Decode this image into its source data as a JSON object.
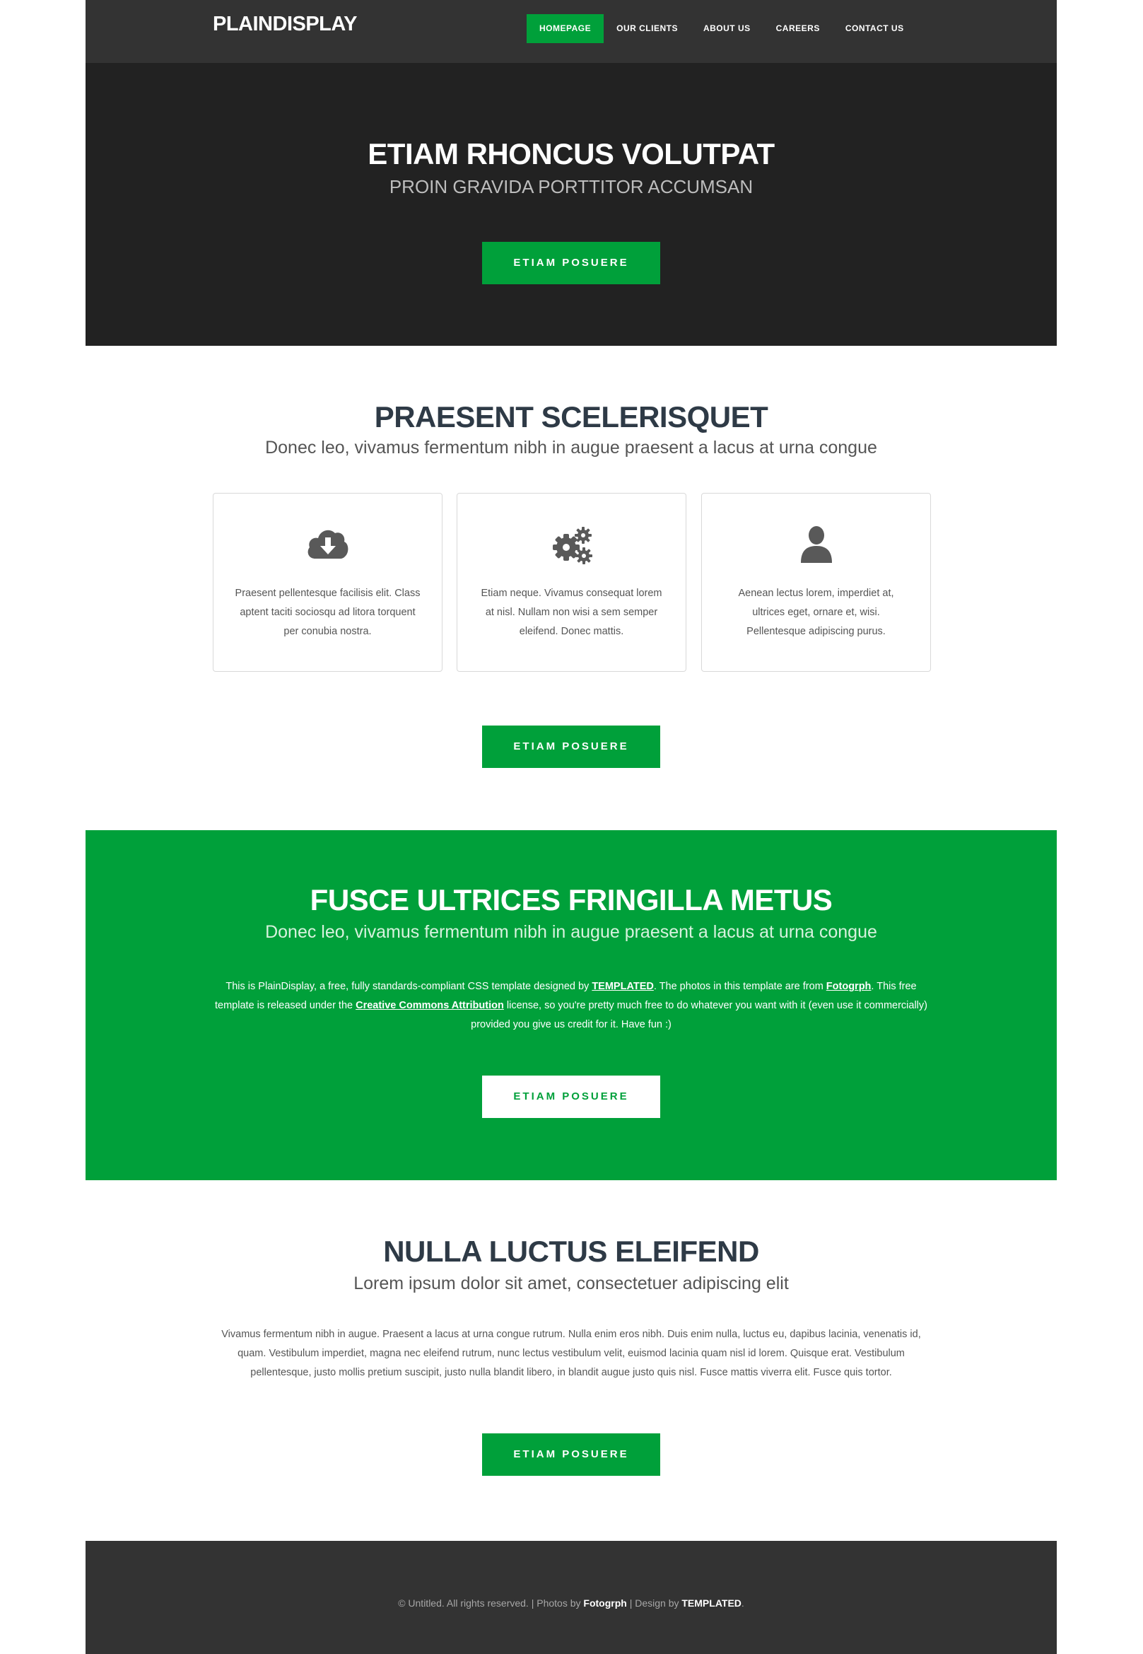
{
  "header": {
    "logo": "PLAINDISPLAY",
    "nav": [
      {
        "label": "HOMEPAGE",
        "active": true
      },
      {
        "label": "OUR CLIENTS",
        "active": false
      },
      {
        "label": "ABOUT US",
        "active": false
      },
      {
        "label": "CAREERS",
        "active": false
      },
      {
        "label": "CONTACT US",
        "active": false
      }
    ]
  },
  "hero": {
    "title": "ETIAM RHONCUS VOLUTPAT",
    "subtitle": "PROIN GRAVIDA PORTTITOR ACCUMSAN",
    "button": "ETIAM POSUERE"
  },
  "features": {
    "title": "PRAESENT SCELERISQUET",
    "subtitle": "Donec leo, vivamus fermentum nibh in augue praesent a lacus at urna congue",
    "cards": [
      {
        "icon": "cloud-download-icon",
        "text": "Praesent pellentesque facilisis elit. Class aptent taciti sociosqu ad litora torquent per conubia nostra."
      },
      {
        "icon": "gears-icon",
        "text": "Etiam neque. Vivamus consequat lorem at nisl. Nullam non wisi a sem semper eleifend. Donec mattis."
      },
      {
        "icon": "user-icon",
        "text": "Aenean lectus lorem, imperdiet at, ultrices eget, ornare et, wisi. Pellentesque adipiscing purus."
      }
    ],
    "button": "ETIAM POSUERE"
  },
  "green": {
    "title": "FUSCE ULTRICES FRINGILLA METUS",
    "subtitle": "Donec leo, vivamus fermentum nibh in augue praesent a lacus at urna congue",
    "para_1": "This is PlainDisplay, a free, fully standards-compliant CSS template designed by ",
    "link_templated": "TEMPLATED",
    "para_2": ". The photos in this template are from ",
    "link_fotogrph": "Fotogrph",
    "para_3": ". This free template is released under the ",
    "link_cc": "Creative Commons Attribution",
    "para_4": " license, so you're pretty much free to do whatever you want with it (even use it commercially) provided you give us credit for it. Have fun :)",
    "button": "ETIAM POSUERE"
  },
  "nulla": {
    "title": "NULLA LUCTUS ELEIFEND",
    "subtitle": "Lorem ipsum dolor sit amet, consectetuer adipiscing elit",
    "text": "Vivamus fermentum nibh in augue. Praesent a lacus at urna congue rutrum. Nulla enim eros nibh. Duis enim nulla, luctus eu, dapibus lacinia, venenatis id, quam. Vestibulum imperdiet, magna nec eleifend rutrum, nunc lectus vestibulum velit, euismod lacinia quam nisl id lorem. Quisque erat. Vestibulum pellentesque, justo mollis pretium suscipit, justo nulla blandit libero, in blandit augue justo quis nisl. Fusce mattis viverra elit. Fusce quis tortor.",
    "button": "ETIAM POSUERE"
  },
  "footer": {
    "prefix": "© Untitled. All rights reserved. | Photos by ",
    "photos_link": "Fotogrph",
    "middle": " | Design by ",
    "design_link": "TEMPLATED",
    "suffix": "."
  },
  "colors": {
    "accent": "#00a03a",
    "header_bg": "#333333",
    "hero_bg": "#222222",
    "footer_bg": "#333333"
  }
}
